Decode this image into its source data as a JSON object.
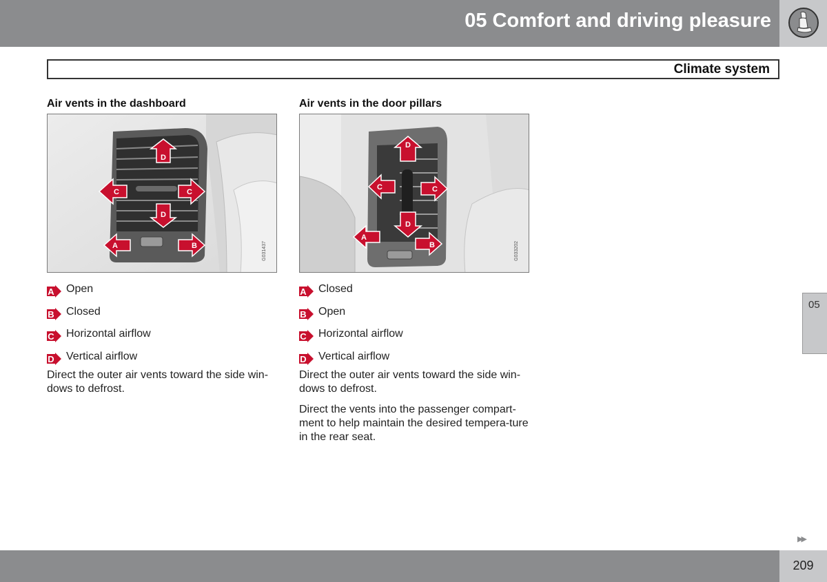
{
  "header": {
    "chapter_title": "05 Comfort and driving pleasure",
    "chapter_icon": "seat-icon",
    "section_title": "Climate system"
  },
  "colors": {
    "header_gray": "#8b8c8e",
    "light_gray": "#c7c8ca",
    "arrow_red": "#c8102e"
  },
  "left_column": {
    "heading": "Air vents in the dashboard",
    "figure_code": "G031437",
    "figure_labels": [
      "D",
      "C",
      "C",
      "D",
      "A",
      "B"
    ],
    "legend": [
      {
        "badge": "A",
        "text": "Open"
      },
      {
        "badge": "B",
        "text": "Closed"
      },
      {
        "badge": "C",
        "text": "Horizontal airflow"
      },
      {
        "badge": "D",
        "text": "Vertical airflow"
      }
    ],
    "paragraphs": [
      "Direct the outer air vents toward the side win-dows to defrost."
    ]
  },
  "right_column": {
    "heading": "Air vents in the door pillars",
    "figure_code": "G033202",
    "figure_labels": [
      "D",
      "C",
      "C",
      "D",
      "A",
      "B"
    ],
    "legend": [
      {
        "badge": "A",
        "text": "Closed"
      },
      {
        "badge": "B",
        "text": "Open"
      },
      {
        "badge": "C",
        "text": "Horizontal airflow"
      },
      {
        "badge": "D",
        "text": "Vertical airflow"
      }
    ],
    "paragraphs": [
      "Direct the outer air vents toward the side win-dows to defrost.",
      "Direct the vents into the passenger compart-ment to help maintain the desired tempera-ture in the rear seat."
    ]
  },
  "side_tab": {
    "label": "05"
  },
  "footer": {
    "next_page_icon": "double-arrow-right-icon",
    "page_number": "209"
  }
}
